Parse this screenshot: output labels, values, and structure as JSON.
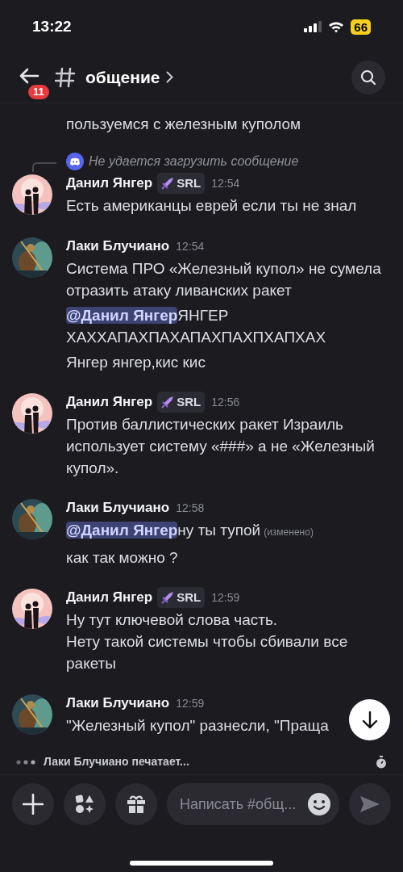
{
  "status_bar": {
    "time": "13:22",
    "battery": "66"
  },
  "header": {
    "unread_badge": "11",
    "channel": "общение"
  },
  "messages": [
    {
      "kind": "continuation",
      "paragraphs": [
        [
          {
            "kind": "text",
            "text": "пользуемся с железным куполом"
          }
        ]
      ]
    },
    {
      "kind": "message",
      "avatar": {
        "kind": "couple"
      },
      "reply": "Не удается загрузить сообщение",
      "author": "Данил Янгер",
      "role_badge": "SRL",
      "time": "12:54",
      "paragraphs": [
        [
          {
            "kind": "text",
            "text": "Есть американцы еврей если ты не знал"
          }
        ]
      ]
    },
    {
      "kind": "message",
      "avatar": {
        "kind": "warrior"
      },
      "author": "Лаки Блучиано",
      "time": "12:54",
      "paragraphs": [
        [
          {
            "kind": "text",
            "text": "Система ПРО «Железный купол» не сумела отразить атаку ливанских ракет"
          }
        ],
        [
          {
            "kind": "mention",
            "text": "@Данил Янгер"
          },
          {
            "kind": "text",
            "text": "ЯНГЕР ХАХХАПАХПАХАПАХПАХПХАПХАХ"
          }
        ],
        [
          {
            "kind": "text",
            "text": "Янгер янгер,кис кис"
          }
        ]
      ]
    },
    {
      "kind": "message",
      "avatar": {
        "kind": "couple"
      },
      "author": "Данил Янгер",
      "role_badge": "SRL",
      "time": "12:56",
      "paragraphs": [
        [
          {
            "kind": "text",
            "text": "Против баллистических ракет Израиль использует систему «###» а не «Железный купол»."
          }
        ]
      ]
    },
    {
      "kind": "message",
      "avatar": {
        "kind": "warrior"
      },
      "author": "Лаки Блучиано",
      "time": "12:58",
      "paragraphs": [
        [
          {
            "kind": "mention",
            "text": "@Данил Янгер"
          },
          {
            "kind": "text",
            "text": "ну ты тупой"
          },
          {
            "kind": "edited",
            "text": "(изменено)"
          }
        ],
        [
          {
            "kind": "text",
            "text": "как так можно ?"
          }
        ]
      ]
    },
    {
      "kind": "message",
      "avatar": {
        "kind": "couple"
      },
      "author": "Данил Янгер",
      "role_badge": "SRL",
      "time": "12:59",
      "paragraphs": [
        [
          {
            "kind": "text",
            "text": "Ну тут ключевой слова часть."
          }
        ],
        [
          {
            "kind": "text",
            "text": "Нету такой системы чтобы сбивали все ракеты"
          }
        ]
      ]
    },
    {
      "kind": "message",
      "avatar": {
        "kind": "warrior"
      },
      "author": "Лаки Блучиано",
      "time": "12:59",
      "paragraphs": [
        [
          {
            "kind": "text",
            "text": "\"Железный купол\" разнесли, \"Праща"
          }
        ]
      ]
    }
  ],
  "typing": "Лаки Блучиано печатает...",
  "composer": {
    "placeholder": "Написать #общ..."
  }
}
